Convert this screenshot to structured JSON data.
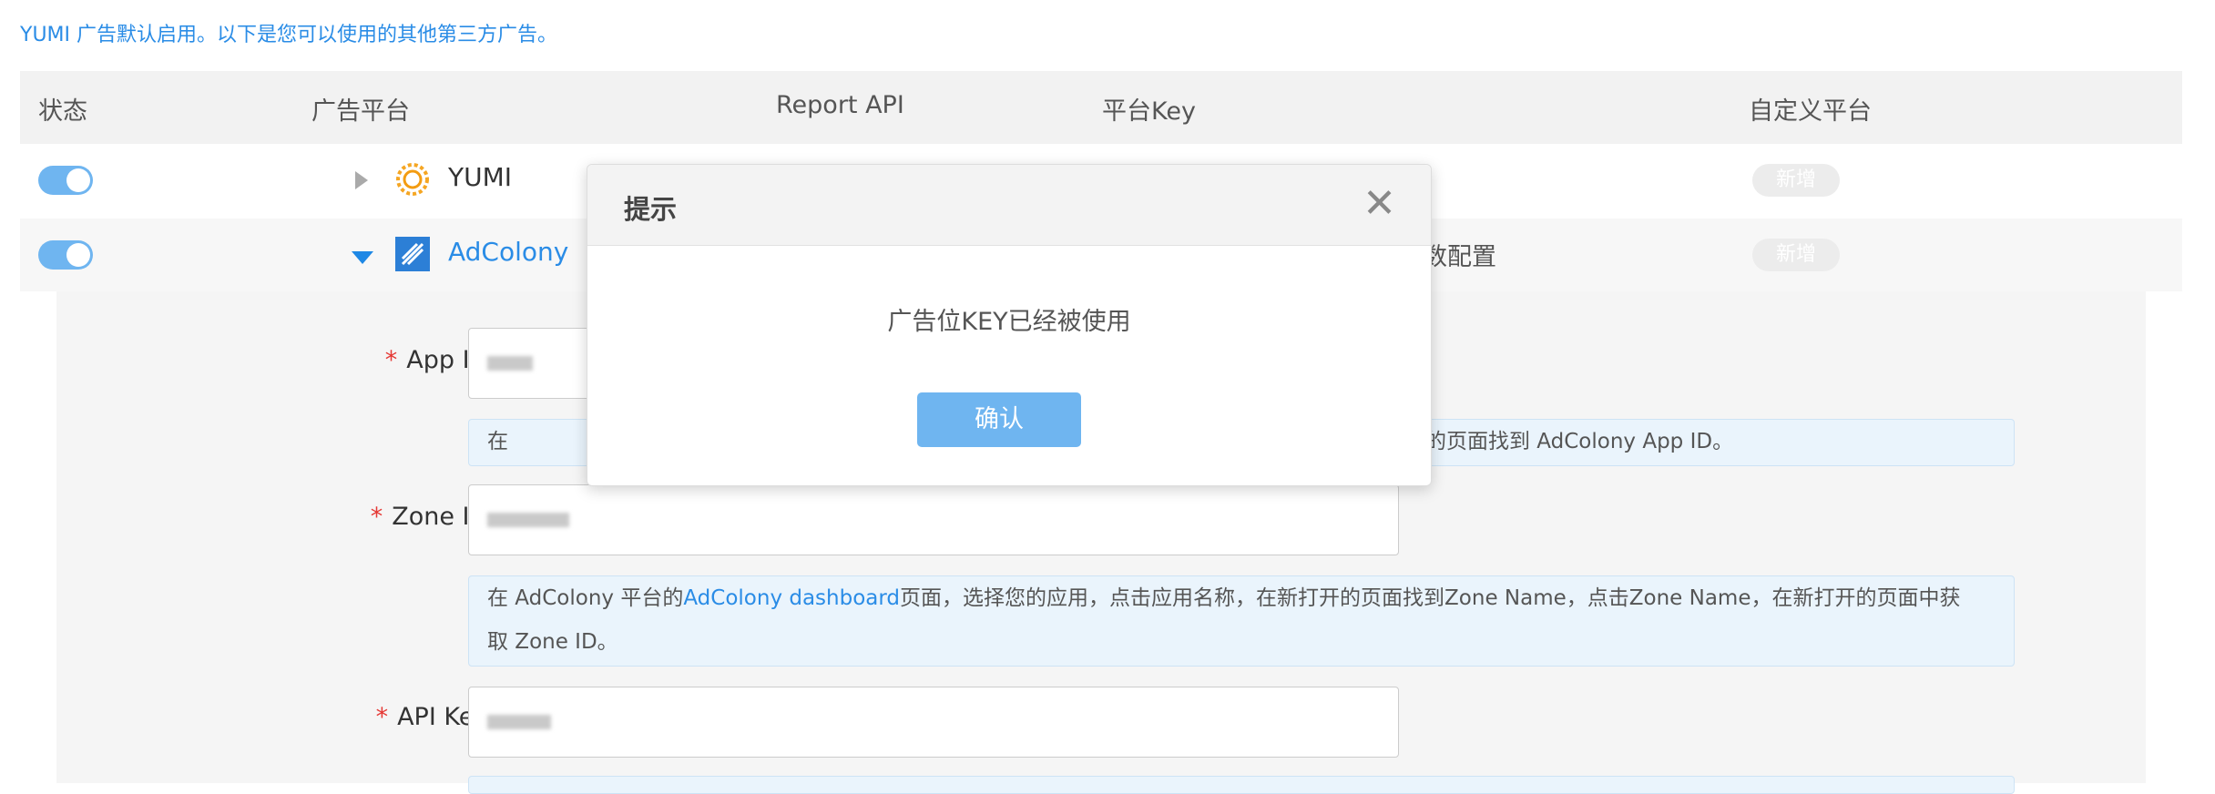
{
  "notice": "YUMI 广告默认启用。以下是您可以使用的其他第三方广告。",
  "table": {
    "headers": {
      "status": "状态",
      "platform": "广告平台",
      "report_api": "Report API",
      "platform_key": "平台Key",
      "custom_platform": "自定义平台"
    },
    "rows": [
      {
        "name": "YUMI",
        "enabled": true,
        "expanded": false,
        "add_label": "新增",
        "icon": "yumi-sun-icon"
      },
      {
        "name": "AdColony",
        "enabled": true,
        "expanded": true,
        "add_label": "新增",
        "key_status_partial": "数配置",
        "icon": "adcolony-icon"
      }
    ]
  },
  "form": {
    "app_id": {
      "label": "App ID :",
      "hint_left": "在",
      "hint_right": "的页面找到 AdColony App ID。"
    },
    "zone_id": {
      "label": "Zone ID :",
      "hint_prefix": "在 AdColony 平台的",
      "hint_link": "AdColony dashboard",
      "hint_suffix": "页面，选择您的应用，点击应用名称，在新打开的页面找到Zone Name，点击Zone Name，在新打开的页面中获",
      "hint_line2": "取 Zone ID。"
    },
    "api_key": {
      "label": "API Key :"
    }
  },
  "modal": {
    "title": "提示",
    "message": "广告位KEY已经被使用",
    "confirm_label": "确认",
    "close_glyph": "✕"
  },
  "colors": {
    "accent": "#2a8ce6",
    "toggle_on": "#6fb5f0",
    "required": "#e53935"
  }
}
